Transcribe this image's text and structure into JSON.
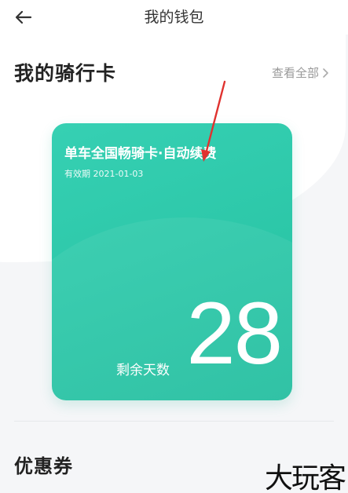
{
  "header": {
    "back_icon": "back-arrow-icon",
    "title": "我的钱包"
  },
  "cards_section": {
    "title": "我的骑行卡",
    "view_all": "查看全部",
    "view_all_icon": "chevron-right-icon"
  },
  "ride_card": {
    "name": "单车全国畅骑卡·自动续费",
    "expiry": "有效期 2021-01-03",
    "remaining_label": "剩余天数",
    "remaining_days": "28",
    "color": "#2cc7a8"
  },
  "coupons_section": {
    "title": "优惠券"
  },
  "watermark": {
    "text": "大玩客"
  },
  "annotation": {
    "color": "#e0322f"
  }
}
